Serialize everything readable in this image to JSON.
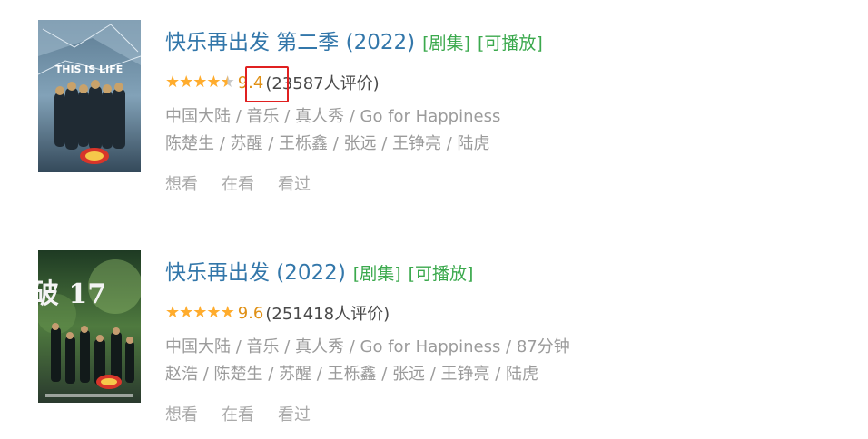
{
  "items": [
    {
      "title": "快乐再出发 第二季 (2022)",
      "tag_type": "[剧集]",
      "tag_play": "[可播放]",
      "stars_full": 4,
      "stars_half": 1,
      "score": "9.4",
      "votes": "(23587人评价)",
      "genres": "中国大陆 / 音乐 / 真人秀 / Go for Happiness",
      "cast": "陈楚生 / 苏醒 / 王栎鑫 / 张远 / 王铮亮 / 陆虎",
      "actions": [
        "想看",
        "在看",
        "看过"
      ],
      "poster_text": "THIS IS LIFE"
    },
    {
      "title": "快乐再出发 (2022)",
      "tag_type": "[剧集]",
      "tag_play": "[可播放]",
      "stars_full": 5,
      "stars_half": 0,
      "score": "9.6",
      "votes": "(251418人评价)",
      "genres": "中国大陆 / 音乐 / 真人秀 / Go for Happiness / 87分钟",
      "cast": "赵浩 / 陈楚生 / 苏醒 / 王栎鑫 / 张远 / 王铮亮 / 陆虎",
      "actions": [
        "想看",
        "在看",
        "看过"
      ],
      "poster_text": "破 17"
    }
  ],
  "colors": {
    "title": "#3377aa",
    "tag": "#3ba94d",
    "star": "#ffac2d",
    "score": "#e09015",
    "highlight": "#e02020"
  }
}
